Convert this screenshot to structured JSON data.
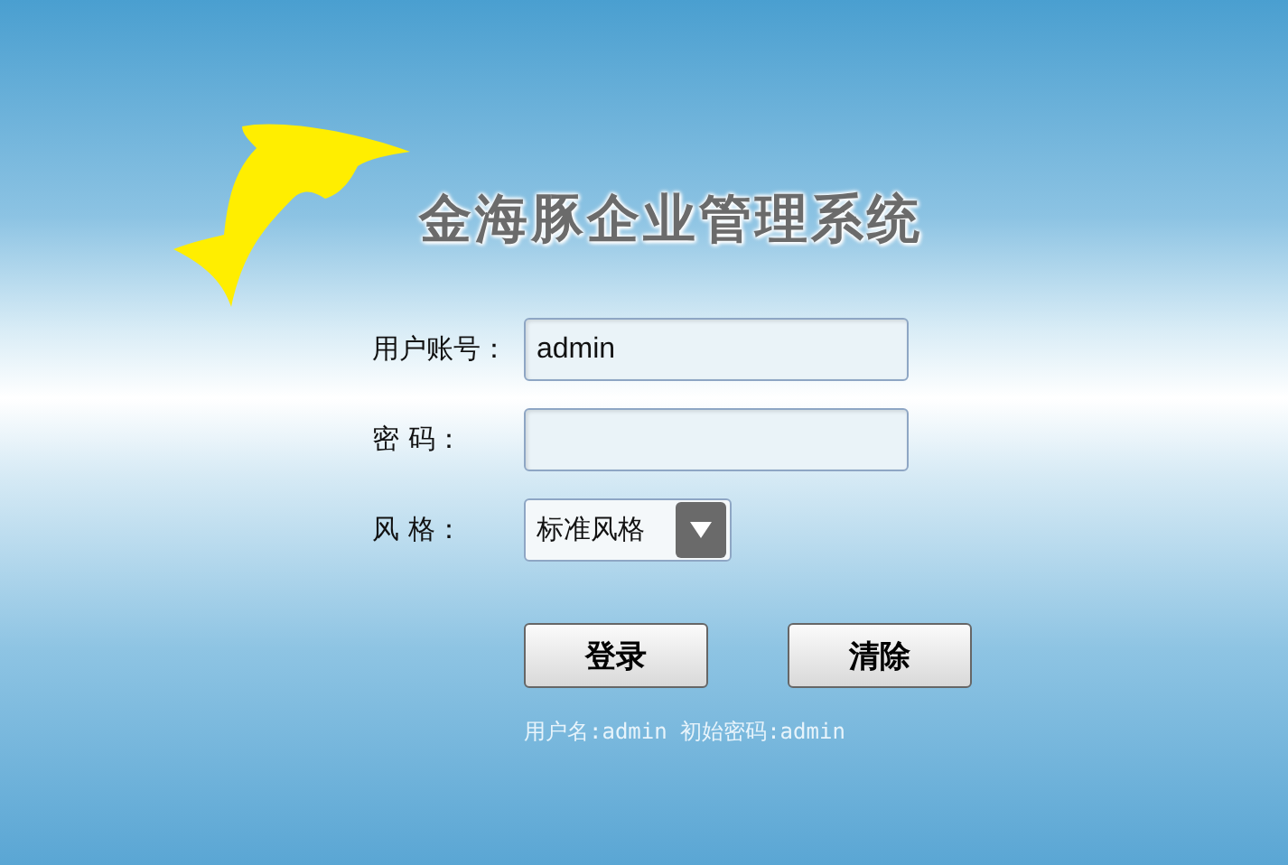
{
  "title": "金海豚企业管理系统",
  "fields": [
    {
      "label": "用户账号：",
      "kind": "text",
      "value": "admin"
    },
    {
      "label": "密 码：",
      "kind": "password"
    },
    {
      "label": "风 格：",
      "kind": "select",
      "value": "标准风格"
    }
  ],
  "buttons": [
    "登录",
    "清除"
  ],
  "hint": "用户名:admin 初始密码:admin"
}
